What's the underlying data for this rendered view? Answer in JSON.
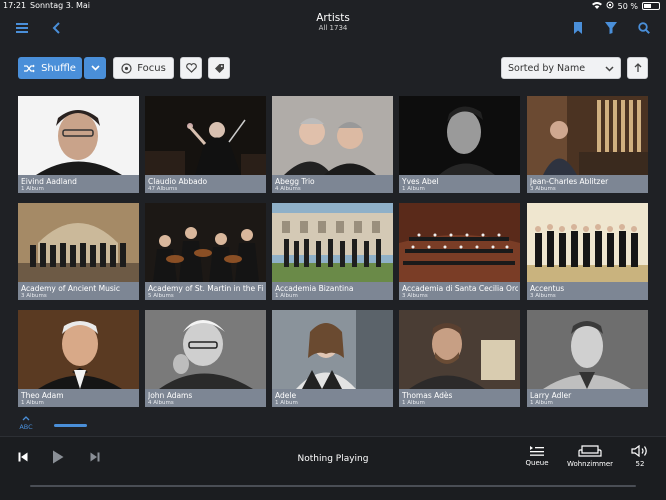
{
  "status": {
    "time": "17:21",
    "date": "Sonntag 3. Mai",
    "battery": "50 %",
    "battery_level": 0.5
  },
  "nav": {
    "title": "Artists",
    "subtitle": "All 1734"
  },
  "toolbar": {
    "shuffle_label": "Shuffle",
    "focus_label": "Focus",
    "sort_value": "Sorted by Name"
  },
  "icons": {
    "menu": "hamburger-icon",
    "back": "back-chevron-icon",
    "bookmark": "bookmark-icon",
    "filter": "filter-icon",
    "search": "search-icon",
    "shuffle": "shuffle-icon",
    "dropdown": "chevron-down-icon",
    "focus": "focus-icon",
    "heart": "heart-icon",
    "tag": "tag-icon",
    "sort_dir": "arrow-up-icon"
  },
  "colors": {
    "accent": "#4a8fd9",
    "background": "#1f2125",
    "caption": "#7d8694",
    "player": "#1b1d20"
  },
  "artists": [
    {
      "name": "Eivind Aadland",
      "albums": "1 Album"
    },
    {
      "name": "Claudio Abbado",
      "albums": "47 Albums"
    },
    {
      "name": "Abegg Trio",
      "albums": "4 Albums"
    },
    {
      "name": "Yves Abel",
      "albums": "1 Album"
    },
    {
      "name": "Jean-Charles Ablitzer",
      "albums": "3 Albums"
    },
    {
      "name": "Academy of Ancient Music",
      "albums": "3 Albums"
    },
    {
      "name": "Academy of St. Martin in the Fi",
      "albums": "5 Albums"
    },
    {
      "name": "Accademia Bizantina",
      "albums": "1 Album"
    },
    {
      "name": "Accademia di Santa Cecilia Orc",
      "albums": "3 Albums"
    },
    {
      "name": "Accentus",
      "albums": "3 Albums"
    },
    {
      "name": "Theo Adam",
      "albums": "1 Album"
    },
    {
      "name": "John Adams",
      "albums": "4 Albums"
    },
    {
      "name": "Adele",
      "albums": "1 Album"
    },
    {
      "name": "Thomas Adès",
      "albums": "1 Album"
    },
    {
      "name": "Larry Adler",
      "albums": "1 Album"
    }
  ],
  "index": {
    "label": "ABC"
  },
  "player": {
    "now_playing": "Nothing Playing",
    "queue_label": "Queue",
    "zone_label": "Wohnzimmer",
    "volume": "52"
  }
}
